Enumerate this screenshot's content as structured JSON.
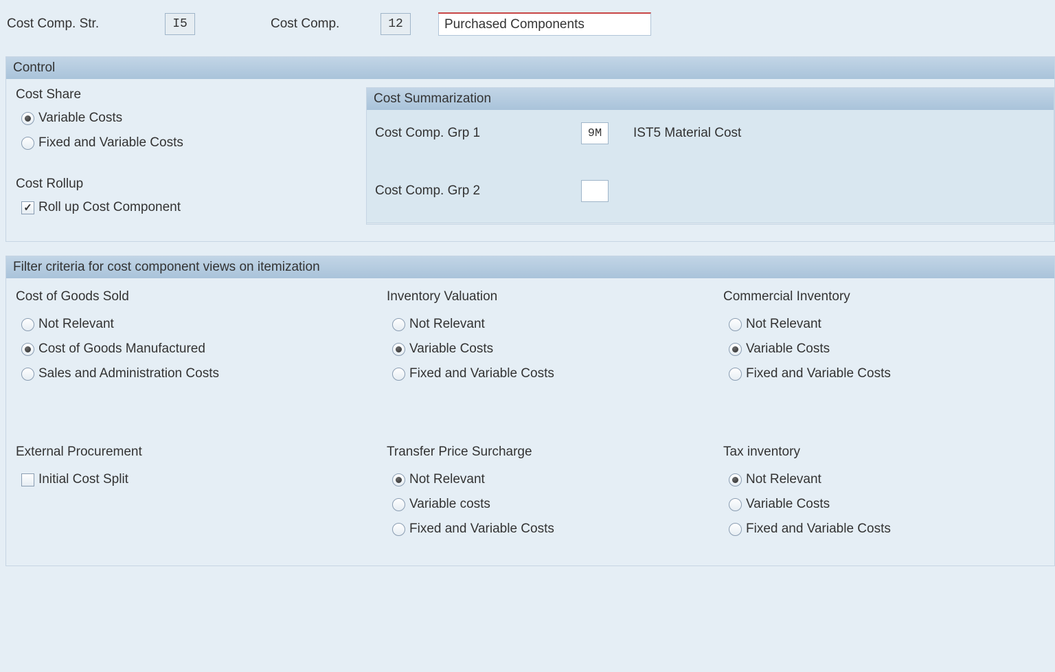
{
  "header": {
    "cost_comp_str_label": "Cost Comp. Str.",
    "cost_comp_str_value": "I5",
    "cost_comp_label": "Cost Comp.",
    "cost_comp_value": "12",
    "name_value": "Purchased Components"
  },
  "control": {
    "panel_title": "Control",
    "cost_share": {
      "label": "Cost Share",
      "options": [
        "Variable Costs",
        "Fixed and Variable Costs"
      ],
      "selected": 0
    },
    "cost_rollup": {
      "label": "Cost Rollup",
      "checkbox_label": "Roll up Cost Component",
      "checked": true
    },
    "summarization": {
      "title": "Cost Summarization",
      "grp1_label": "Cost Comp. Grp 1",
      "grp1_value": "9M",
      "grp1_desc": "IST5 Material Cost",
      "grp2_label": "Cost Comp. Grp 2",
      "grp2_value": "",
      "grp2_desc": ""
    }
  },
  "filter": {
    "panel_title": "Filter criteria for cost component views on itemization",
    "cogs": {
      "label": "Cost of Goods Sold",
      "options": [
        "Not Relevant",
        "Cost of Goods Manufactured",
        "Sales and Administration Costs"
      ],
      "selected": 1
    },
    "inventory_valuation": {
      "label": "Inventory Valuation",
      "options": [
        "Not Relevant",
        "Variable Costs",
        "Fixed and Variable Costs"
      ],
      "selected": 1
    },
    "commercial_inventory": {
      "label": "Commercial Inventory",
      "options": [
        "Not Relevant",
        "Variable Costs",
        "Fixed and Variable Costs"
      ],
      "selected": 1
    },
    "external_procurement": {
      "label": "External Procurement",
      "checkbox_label": "Initial Cost Split",
      "checked": false
    },
    "transfer_price_surcharge": {
      "label": "Transfer Price Surcharge",
      "options": [
        "Not Relevant",
        "Variable costs",
        "Fixed and Variable Costs"
      ],
      "selected": 0
    },
    "tax_inventory": {
      "label": "Tax inventory",
      "options": [
        "Not Relevant",
        "Variable Costs",
        "Fixed and Variable Costs"
      ],
      "selected": 0
    }
  }
}
